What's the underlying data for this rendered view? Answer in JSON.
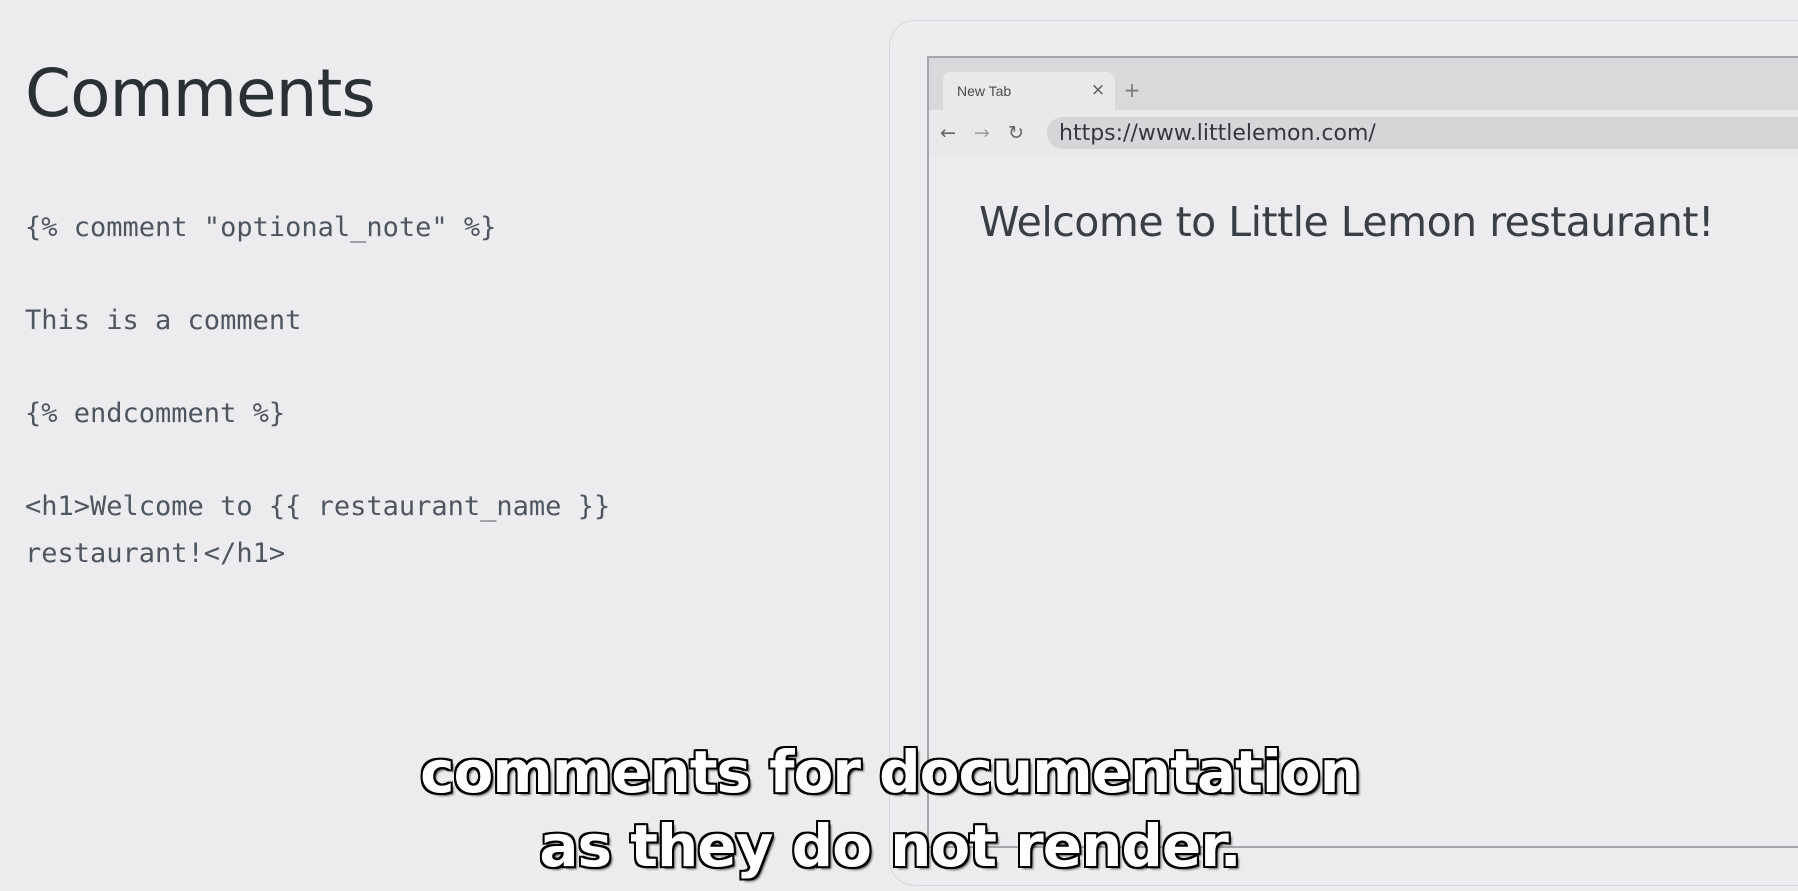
{
  "slide": {
    "title": "Comments",
    "code_lines": [
      "{% comment \"optional_note\" %}",
      "This is a comment",
      "{% endcomment %}",
      "<h1>Welcome to {{ restaurant_name }}",
      "restaurant!</h1>"
    ]
  },
  "browser": {
    "tab_label": "New Tab",
    "tab_close_icon": "×",
    "new_tab_icon": "+",
    "back_icon": "←",
    "forward_icon": "→",
    "reload_icon": "↻",
    "url": "https://www.littlelemon.com/",
    "page_heading": "Welcome to Little Lemon restaurant!"
  },
  "caption": {
    "line1": "comments for documentation",
    "line2": "as they do not render."
  },
  "colors": {
    "background": "#ececee",
    "text_dark": "#2b3035",
    "code_text": "#4f5660",
    "browser_border": "#a6a6aa"
  }
}
